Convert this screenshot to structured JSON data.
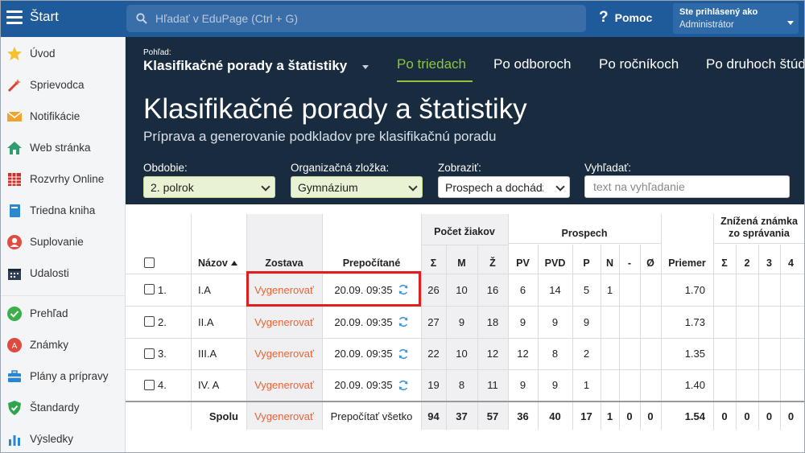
{
  "topbar": {
    "start": "Štart",
    "search_placeholder": "Hľadať v EduPage (Ctrl + G)",
    "help": "Pomoc",
    "user_line1": "Ste prihlásený ako",
    "user_line2": "Administrátor"
  },
  "sidebar": {
    "items": [
      {
        "label": "Úvod",
        "icon": "star-icon"
      },
      {
        "label": "Sprievodca",
        "icon": "wand-icon"
      },
      {
        "label": "Notifikácie",
        "icon": "envelope-icon"
      },
      {
        "label": "Web stránka",
        "icon": "home-icon"
      },
      {
        "label": "Rozvrhy Online",
        "icon": "timetable-icon"
      },
      {
        "label": "Triedna kniha",
        "icon": "book-icon"
      },
      {
        "label": "Suplovanie",
        "icon": "person-icon"
      },
      {
        "label": "Udalosti",
        "icon": "calendar-icon"
      },
      {
        "label": "Prehľad",
        "icon": "check-icon"
      },
      {
        "label": "Známky",
        "icon": "grade-icon"
      },
      {
        "label": "Plány a prípravy",
        "icon": "briefcase-icon"
      },
      {
        "label": "Štandardy",
        "icon": "shield-icon"
      },
      {
        "label": "Výsledky",
        "icon": "barchart-icon"
      }
    ]
  },
  "header": {
    "view_small": "Pohľad:",
    "view_big": "Klasifikačné porady a štatistiky",
    "tabs": [
      "Po triedach",
      "Po odboroch",
      "Po ročníkoch",
      "Po druhoch štúd"
    ],
    "title": "Klasifikačné porady a štatistiky",
    "subtitle": "Príprava a generovanie podkladov pre klasifikačnú poradu"
  },
  "filters": {
    "period_label": "Obdobie:",
    "period_value": "2. polrok",
    "org_label": "Organizačná zložka:",
    "org_value": "Gymnázium",
    "show_label": "Zobraziť:",
    "show_value": "Prospech a dochádzka",
    "search_label": "Vyhľadať:",
    "search_placeholder": "text na vyhľadanie"
  },
  "table": {
    "group_headers": {
      "count": "Počet žiakov",
      "prospech": "Prospech",
      "lowered_1": "Znížená známka",
      "lowered_2": "zo správania"
    },
    "col_headers": {
      "name": "Názov",
      "zostava": "Zostava",
      "prepocitane": "Prepočítané",
      "sum": "Σ",
      "m": "M",
      "z": "Ž",
      "pv": "PV",
      "pvd": "PVD",
      "p": "P",
      "n": "N",
      "dash": "-",
      "o": "Ø",
      "priemer": "Priemer",
      "ls": "Σ",
      "l2": "2",
      "l3": "3",
      "l4": "4"
    },
    "rows": [
      {
        "num": "1.",
        "name": "I.A",
        "action": "Vygenerovať",
        "date": "20.09. 09:35",
        "sum": "26",
        "m": "10",
        "z": "16",
        "pv": "6",
        "pvd": "14",
        "p": "5",
        "n": "1",
        "avg": "1.70"
      },
      {
        "num": "2.",
        "name": "II.A",
        "action": "Vygenerovať",
        "date": "20.09. 09:35",
        "sum": "27",
        "m": "9",
        "z": "18",
        "pv": "9",
        "pvd": "9",
        "p": "9",
        "n": "",
        "avg": "1.73"
      },
      {
        "num": "3.",
        "name": "III.A",
        "action": "Vygenerovať",
        "date": "20.09. 09:35",
        "sum": "22",
        "m": "10",
        "z": "12",
        "pv": "12",
        "pvd": "8",
        "p": "2",
        "n": "",
        "avg": "1.35"
      },
      {
        "num": "4.",
        "name": "IV. A",
        "action": "Vygenerovať",
        "date": "20.09. 09:35",
        "sum": "19",
        "m": "8",
        "z": "11",
        "pv": "9",
        "pvd": "9",
        "p": "1",
        "n": "",
        "avg": "1.40"
      }
    ],
    "total": {
      "label": "Spolu",
      "action": "Vygenerovať",
      "recalc": "Prepočítať všetko",
      "sum": "94",
      "m": "37",
      "z": "57",
      "pv": "36",
      "pvd": "40",
      "p": "17",
      "n": "1",
      "dash": "0",
      "o": "0",
      "avg": "1.54",
      "ls": "0",
      "l2": "0",
      "l3": "0",
      "l4": "0"
    }
  },
  "colors": {
    "accent": "#8cc63e",
    "topbar": "#1f5a9a",
    "header": "#192b3f",
    "action": "#f06030",
    "highlight": "#e02020"
  }
}
